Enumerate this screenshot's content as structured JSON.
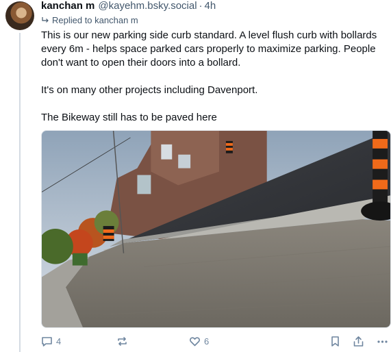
{
  "post": {
    "author": {
      "display_name": "kanchan m",
      "handle": "@kayehm.bsky.social",
      "time_ago": "4h"
    },
    "reply_to": "Replied to kanchan m",
    "paragraphs": [
      "This is our new parking side curb standard. A level flush curb with bollards every 6m - helps space parked cars properly to maximize parking. People don't want to open their doors into a bollard.",
      "It's on many other projects including Davenport.",
      "The Bikeway still has to be paved here"
    ],
    "stats": {
      "replies": "4",
      "likes": "6"
    }
  },
  "colors": {
    "text": "#0b0f14",
    "muted": "#42576c",
    "action": "#6f869f",
    "thread_line": "#d4dbe2"
  },
  "icons": {
    "reply": "reply-icon",
    "repost": "repost-icon",
    "like": "heart-icon",
    "bookmark": "bookmark-icon",
    "share": "share-icon",
    "more": "more-icon"
  }
}
